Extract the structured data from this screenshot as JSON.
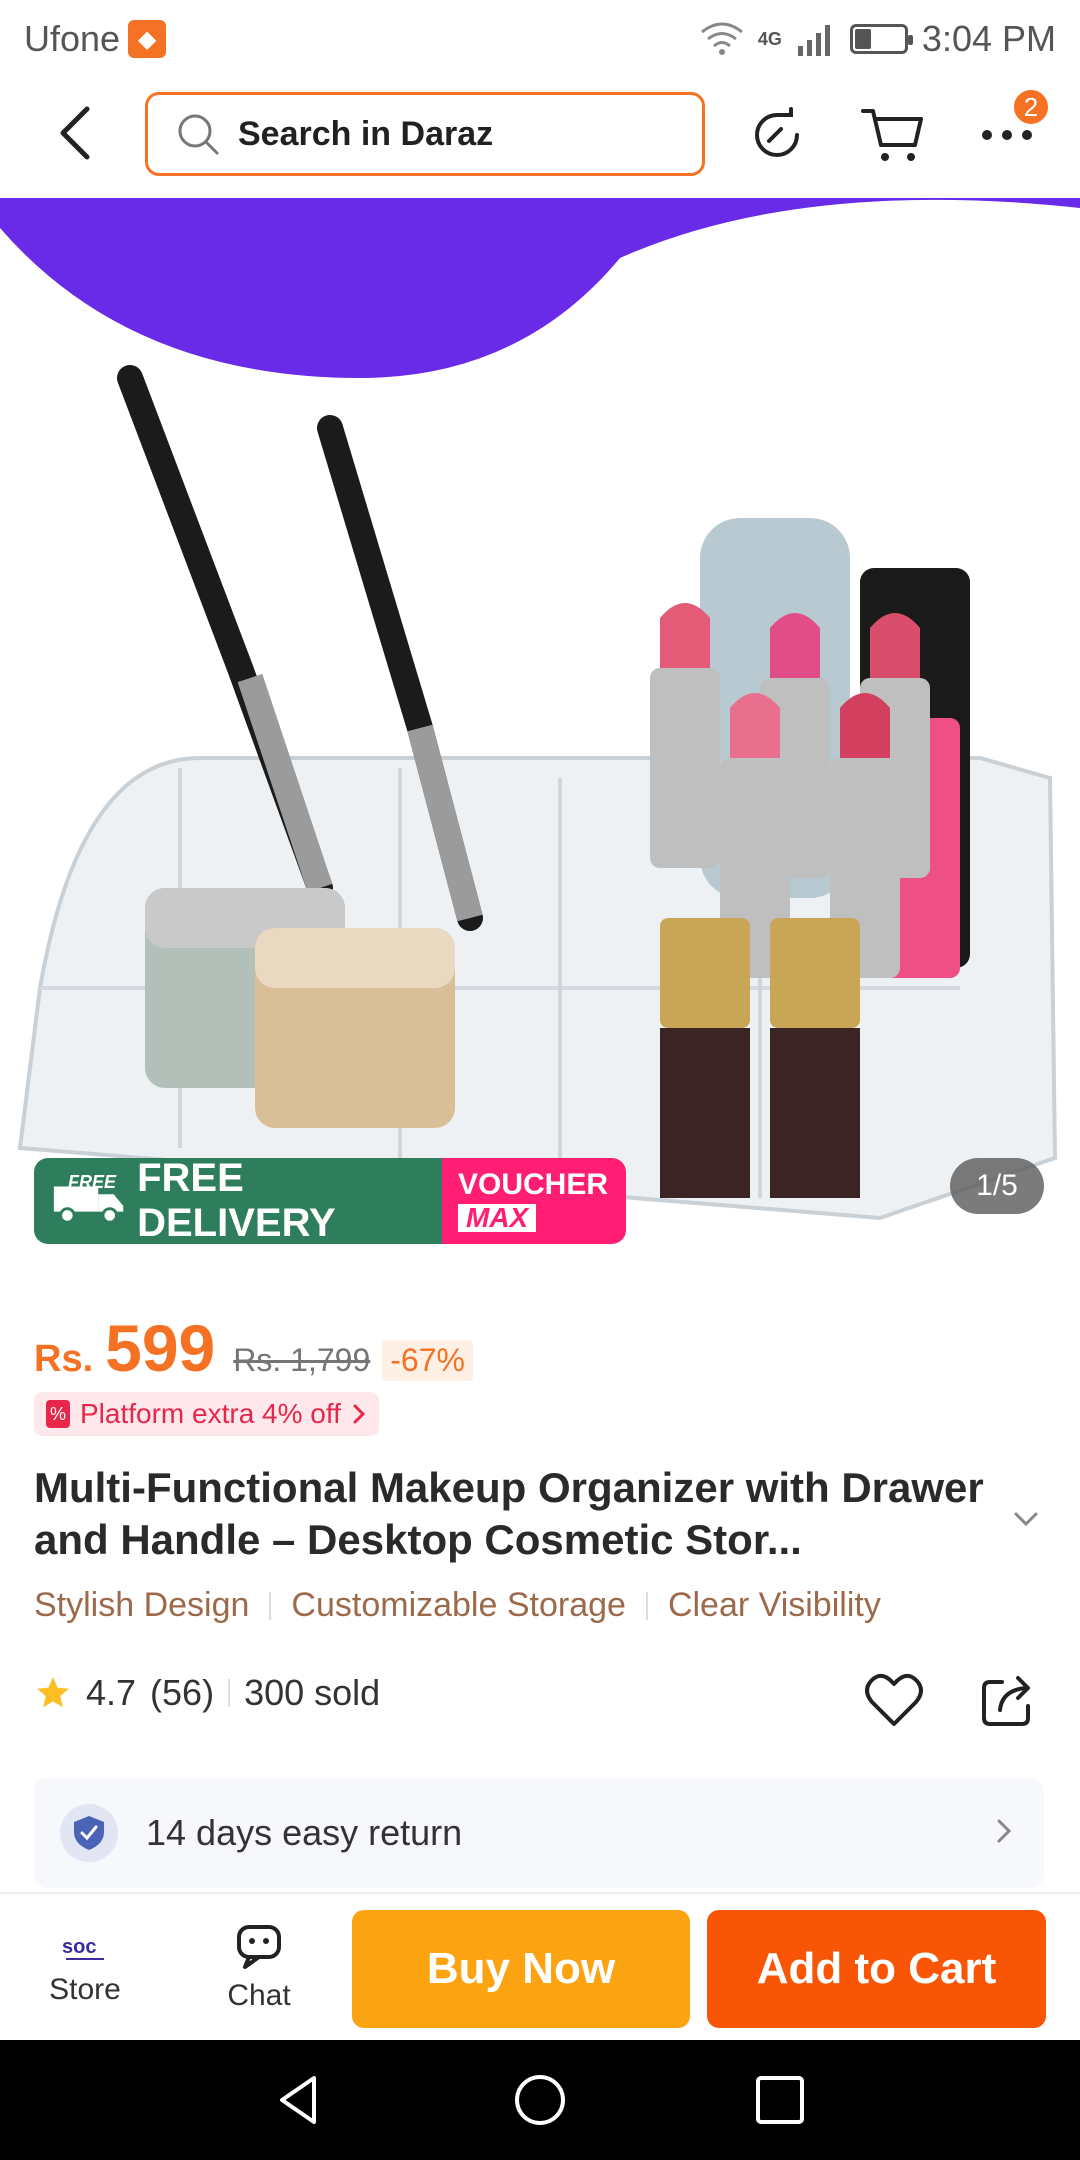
{
  "status_bar": {
    "carrier": "Ufone",
    "network": "4G",
    "time": "3:04 PM",
    "battery_level": 0.3
  },
  "header": {
    "search_placeholder": "Search in Daraz",
    "more_badge": "2"
  },
  "hero": {
    "promo_free_tag": "FREE",
    "promo_delivery": "FREE DELIVERY",
    "promo_voucher": "VOUCHER",
    "promo_max": "MAX",
    "image_counter": "1/5",
    "accent_color": "#6a2be8"
  },
  "price": {
    "currency": "Rs.",
    "value": "599",
    "original": "Rs. 1,799",
    "discount": "-67%"
  },
  "platform_offer": {
    "label": "Platform extra 4% off"
  },
  "product": {
    "title": "Multi-Functional Makeup Organizer with Drawer and Handle – Desktop Cosmetic Stor...",
    "features": [
      "Stylish Design",
      "Customizable Storage",
      "Clear Visibility"
    ],
    "rating": "4.7",
    "review_count": "(56)",
    "sold": "300 sold"
  },
  "return_policy": {
    "label": "14 days easy return"
  },
  "bottom_bar": {
    "store_label": "Store",
    "store_logo": "soc",
    "chat_label": "Chat",
    "buy_now": "Buy Now",
    "add_to_cart": "Add to Cart"
  },
  "colors": {
    "brand_orange": "#f57224",
    "buy_now": "#fca311",
    "add_to_cart": "#f85606",
    "free_delivery_green": "#2e7e5e",
    "voucher_pink": "#ff1e73"
  }
}
